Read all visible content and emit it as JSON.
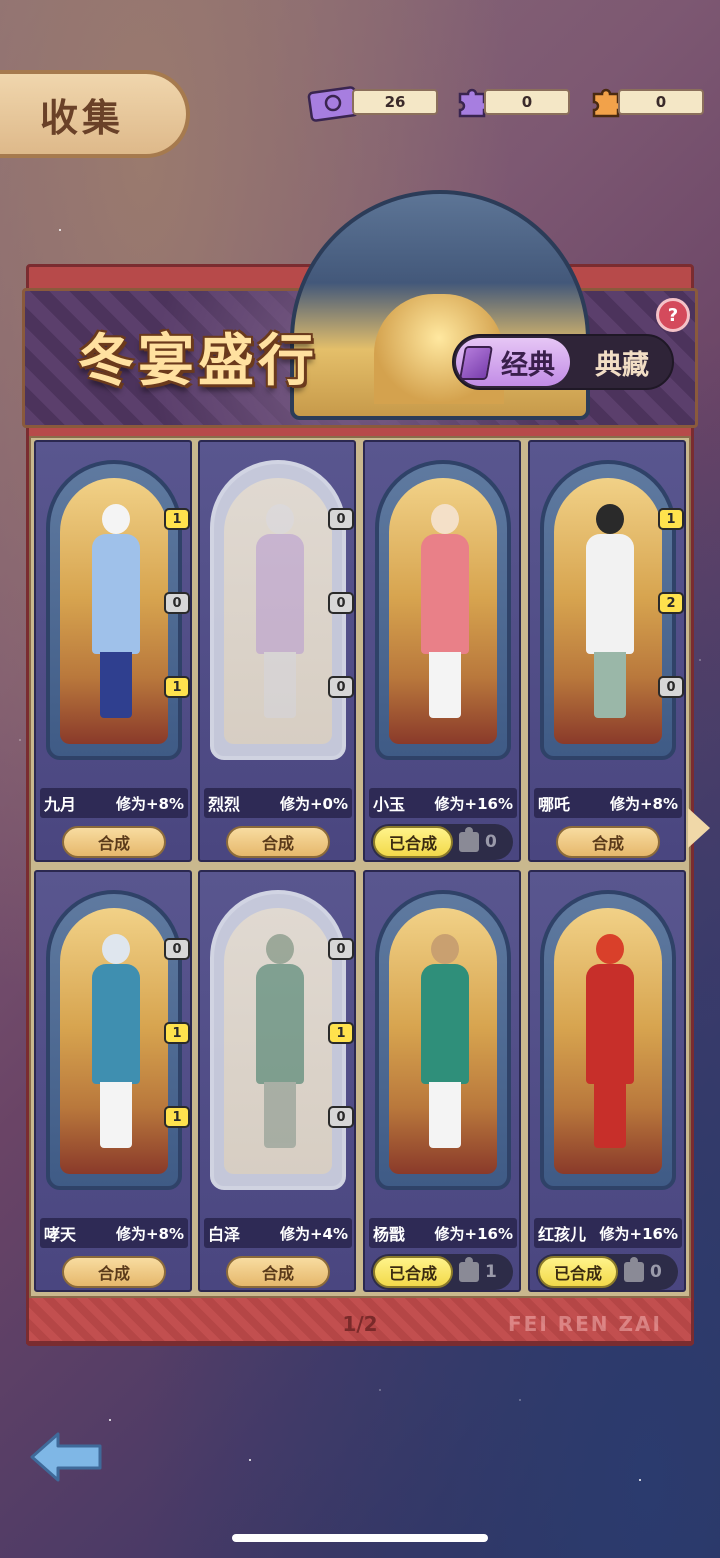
{
  "header": {
    "title": "收集",
    "currencies": [
      {
        "icon": "ticket-icon",
        "value": "26",
        "color": "#a77ee0"
      },
      {
        "icon": "purple-puzzle-icon",
        "value": "0",
        "color": "#a77ee0"
      },
      {
        "icon": "orange-puzzle-icon",
        "value": "0",
        "color": "#f2a24a"
      }
    ]
  },
  "banner": {
    "title": "冬宴盛行",
    "tabs": {
      "active": "经典",
      "inactive": "典藏"
    },
    "help": "?"
  },
  "cards": [
    {
      "name": "九月",
      "bonus": "修为+8%",
      "state": "synth",
      "button": "合成",
      "badges": [
        "1",
        "0",
        "1"
      ],
      "faded": false,
      "colors": {
        "head": "#f4f4f4",
        "body": "#9fc1ea",
        "legs": "#2f3f8f"
      }
    },
    {
      "name": "烈烈",
      "bonus": "修为+0%",
      "state": "synth",
      "button": "合成",
      "badges": [
        "0",
        "0",
        "0"
      ],
      "faded": true,
      "colors": {
        "head": "#f2f2f2",
        "body": "#c9a6de",
        "legs": "#eeeeee"
      }
    },
    {
      "name": "小玉",
      "bonus": "修为+16%",
      "state": "done",
      "button": "已合成",
      "count": "0",
      "badges": [],
      "faded": false,
      "colors": {
        "head": "#f4e0c8",
        "body": "#e98088",
        "legs": "#f4f4f4"
      }
    },
    {
      "name": "哪吒",
      "bonus": "修为+8%",
      "state": "synth",
      "button": "合成",
      "badges": [
        "1",
        "2",
        "0"
      ],
      "faded": false,
      "colors": {
        "head": "#2a2a2a",
        "body": "#f2f2f2",
        "legs": "#9ab7a8"
      }
    },
    {
      "name": "哮天",
      "bonus": "修为+8%",
      "state": "synth",
      "button": "合成",
      "badges": [
        "0",
        "1",
        "1"
      ],
      "faded": false,
      "colors": {
        "head": "#dfe6ee",
        "body": "#3f8fb0",
        "legs": "#f4f4f4"
      }
    },
    {
      "name": "白泽",
      "bonus": "修为+4%",
      "state": "synth",
      "button": "合成",
      "badges": [
        "0",
        "1",
        "0"
      ],
      "faded": true,
      "colors": {
        "head": "#6a8a6a",
        "body": "#2f7a5a",
        "legs": "#8aa08a"
      }
    },
    {
      "name": "杨戬",
      "bonus": "修为+16%",
      "state": "done",
      "button": "已合成",
      "count": "1",
      "badges": [],
      "faded": false,
      "colors": {
        "head": "#c9a070",
        "body": "#2f8f7a",
        "legs": "#f4f4f4"
      }
    },
    {
      "name": "红孩儿",
      "bonus": "修为+16%",
      "state": "done",
      "button": "已合成",
      "count": "0",
      "badges": [],
      "faded": false,
      "colors": {
        "head": "#d9402a",
        "body": "#c72f2a",
        "legs": "#c72f2a"
      }
    }
  ],
  "footer": {
    "page": "1/2",
    "watermark": "FEI REN ZAI"
  }
}
